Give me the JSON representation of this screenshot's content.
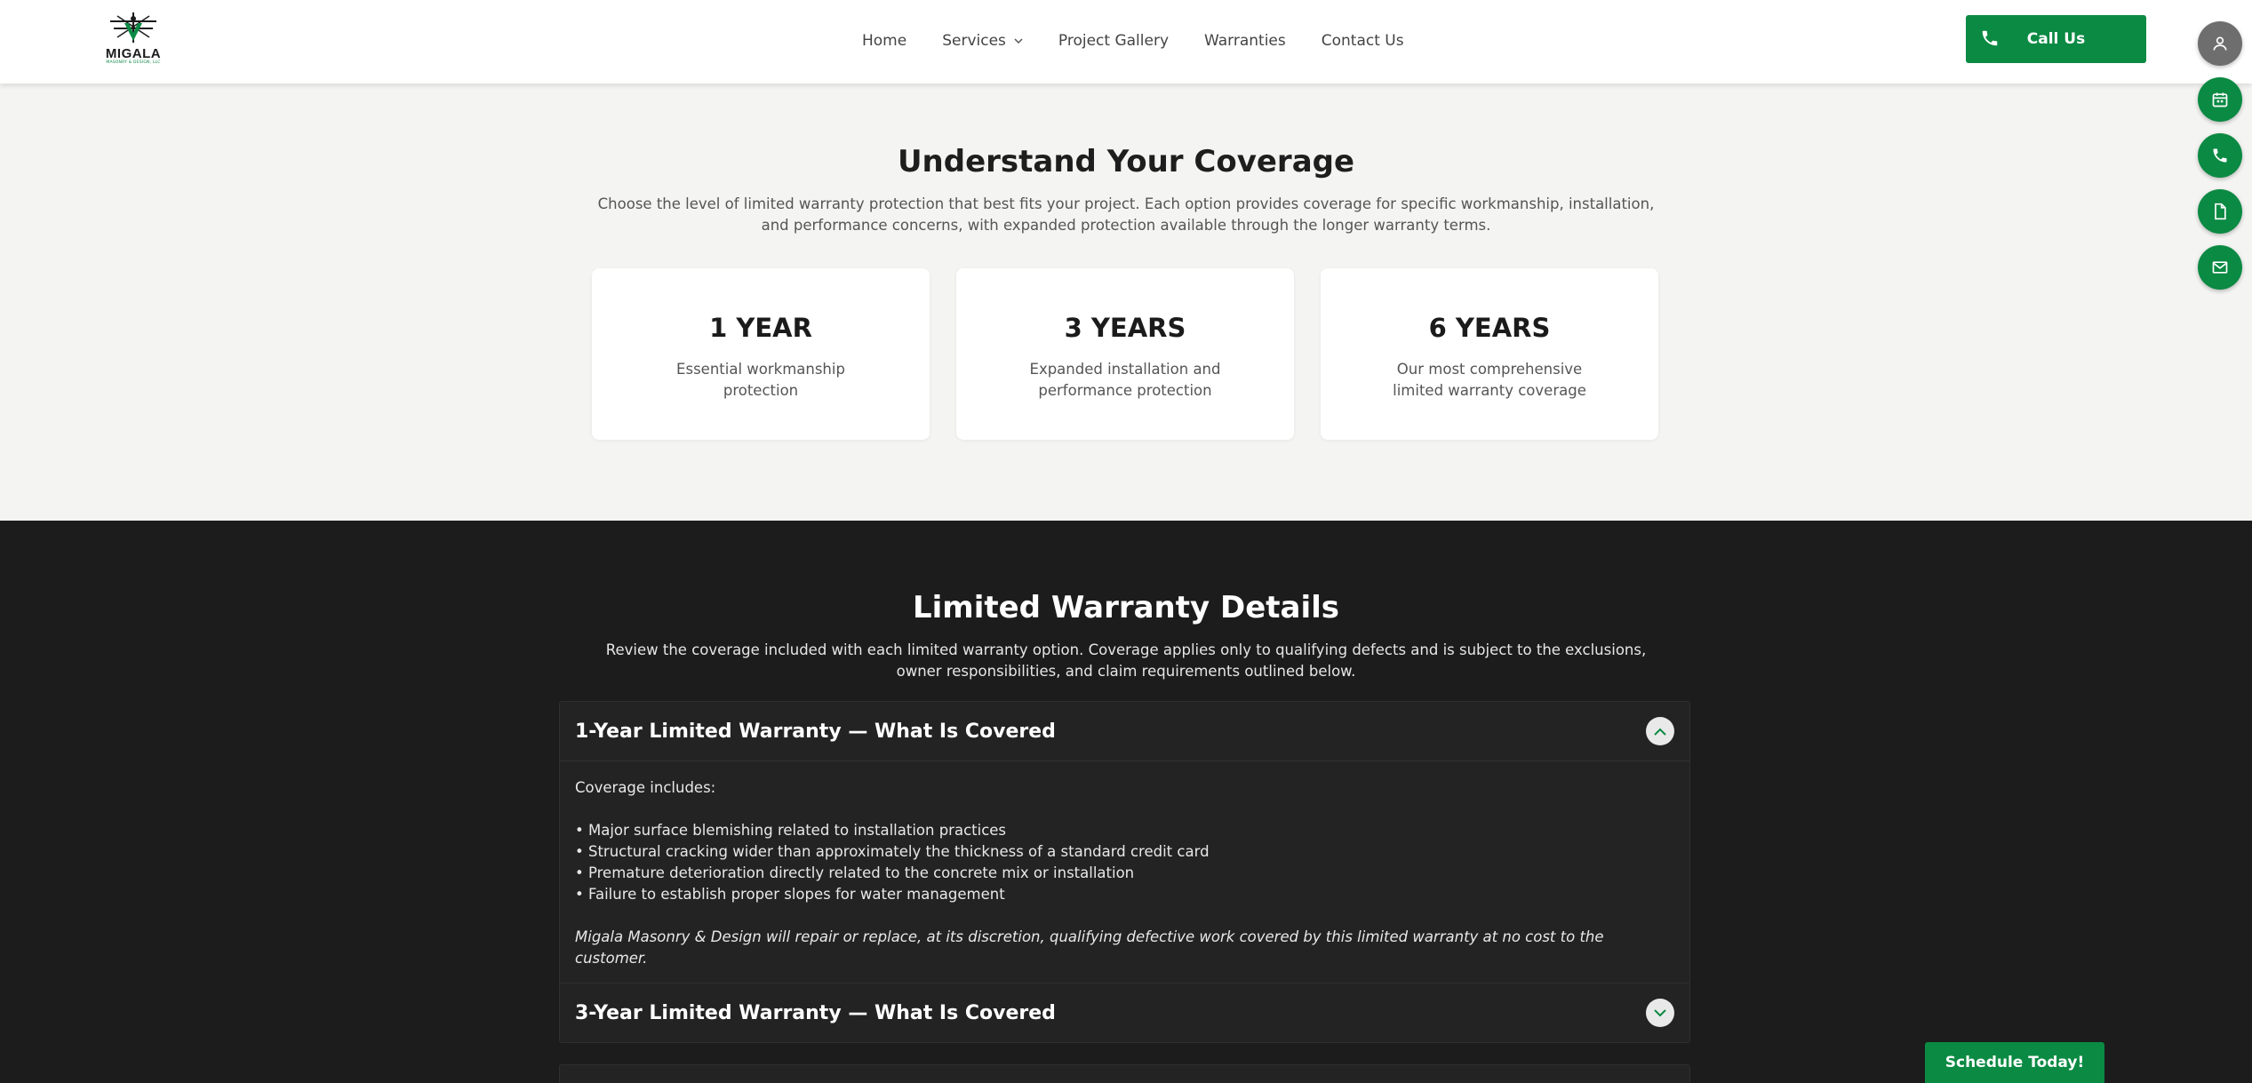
{
  "brand": {
    "name": "MIGALA",
    "subtitle": "MASONRY & DESIGN, LLC",
    "accent": "#0b8a43"
  },
  "nav": {
    "items": [
      {
        "label": "Home"
      },
      {
        "label": "Services",
        "has_dropdown": true
      },
      {
        "label": "Project Gallery"
      },
      {
        "label": "Warranties"
      },
      {
        "label": "Contact Us"
      }
    ],
    "call_label": "Call Us"
  },
  "side_actions": [
    {
      "icon": "user-icon"
    },
    {
      "icon": "calendar-icon"
    },
    {
      "icon": "phone-icon"
    },
    {
      "icon": "document-icon"
    },
    {
      "icon": "mail-icon"
    }
  ],
  "coverage": {
    "title": "Understand Your Coverage",
    "description": "Choose the level of limited warranty protection that best fits your project. Each option provides coverage for specific workmanship, installation, and performance concerns, with expanded protection available through the longer warranty terms.",
    "cards": [
      {
        "title": "1 YEAR",
        "text": "Essential workmanship protection"
      },
      {
        "title": "3 YEARS",
        "text": "Expanded installation and performance protection"
      },
      {
        "title": "6 YEARS",
        "text": "Our most comprehensive limited warranty coverage"
      }
    ]
  },
  "details": {
    "title": "Limited Warranty Details",
    "description": "Review the coverage included with each limited warranty option. Coverage applies only to qualifying defects and is subject to the exclusions, owner responsibilities, and claim requirements outlined below.",
    "accordions": [
      {
        "title": "1-Year Limited Warranty — What Is Covered",
        "expanded": true,
        "intro": "Coverage includes:",
        "items": [
          "• Major surface blemishing related to installation practices",
          "• Structural cracking wider than approximately the thickness of a standard credit card",
          "• Premature deterioration directly related to the concrete mix or installation",
          "• Failure to establish proper slopes for water management"
        ],
        "closing": "Migala Masonry & Design will repair or replace, at its discretion, qualifying defective work covered by this limited warranty at no cost to the customer."
      },
      {
        "title": "3-Year Limited Warranty — What Is Covered",
        "expanded": false
      }
    ]
  },
  "schedule_label": "Schedule Today!"
}
